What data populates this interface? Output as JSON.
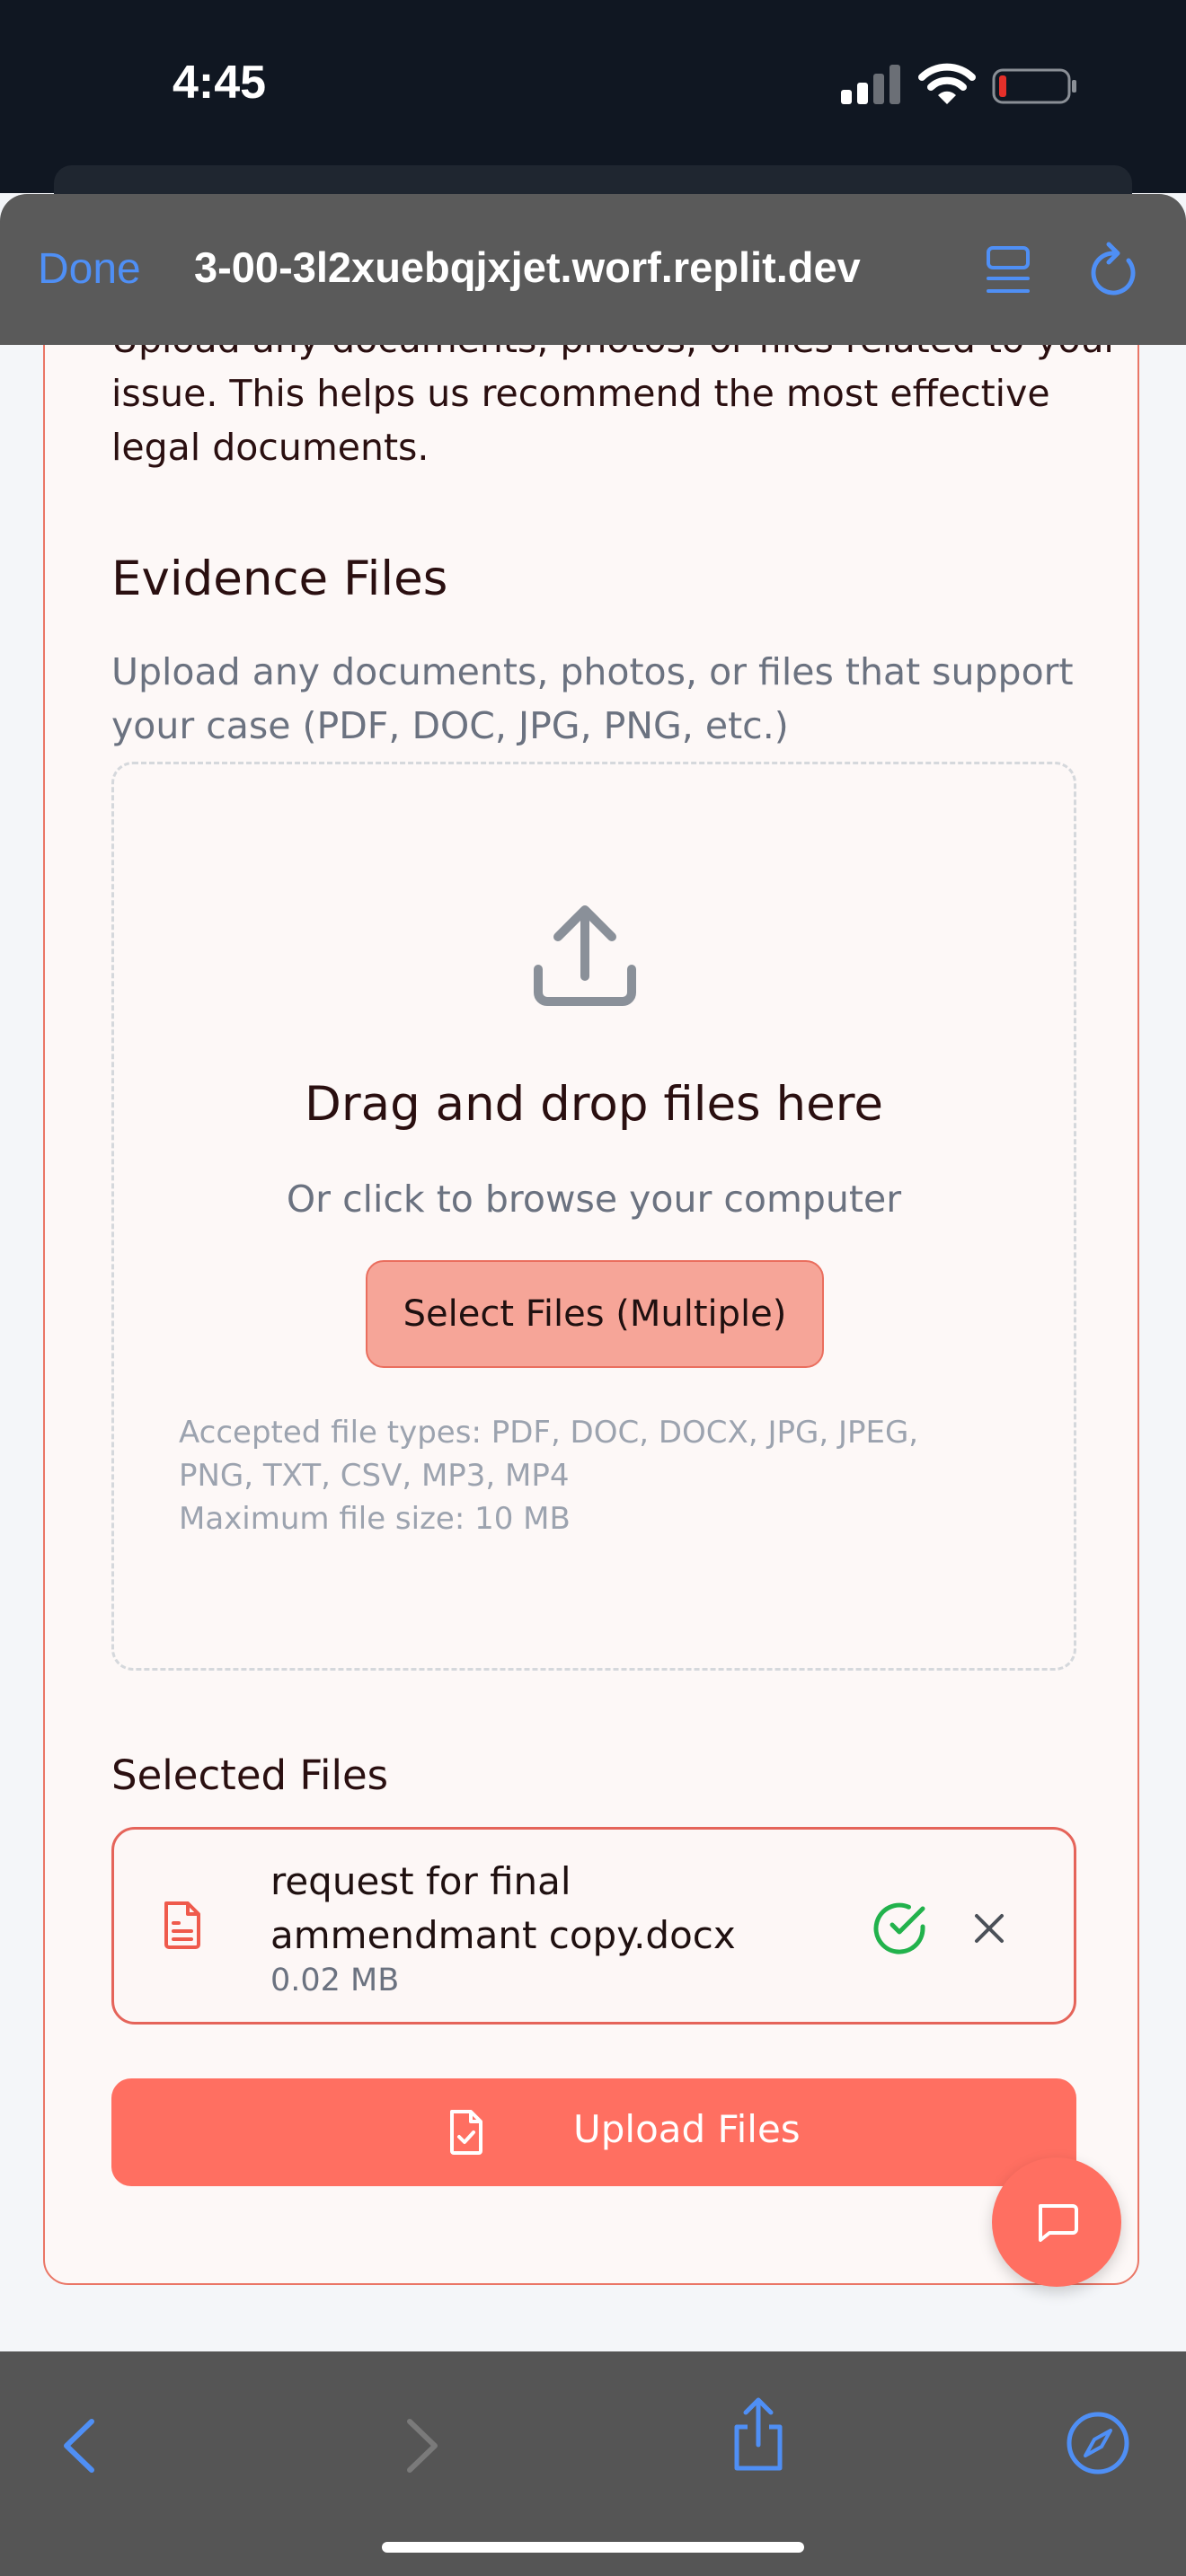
{
  "status_bar": {
    "time": "4:45",
    "icons": [
      "signal-icon",
      "wifi-icon",
      "battery-low-icon"
    ]
  },
  "browser": {
    "done_label": "Done",
    "url": "3-00-3l2xuebqjxjet.worf.replit.dev",
    "icons": [
      "reader-icon",
      "reload-icon"
    ]
  },
  "page": {
    "intro_text": "Upload any documents, photos, or files related to your issue. This helps us recommend the most effective legal documents.",
    "evidence": {
      "title": "Evidence Files",
      "description": "Upload any documents, photos, or files that support your case (PDF, DOC, JPG, PNG, etc.)"
    },
    "dropzone": {
      "title": "Drag and drop files here",
      "subtitle": "Or click to browse your computer",
      "button_label": "Select Files (Multiple)",
      "accepted_types": "Accepted file types: PDF, DOC, DOCX, JPG, JPEG, PNG, TXT, CSV, MP3, MP4",
      "max_size": "Maximum file size: 10 MB"
    },
    "selected": {
      "title": "Selected Files",
      "files": [
        {
          "name": "request for final ammendmant copy.docx",
          "size": "0.02 MB",
          "status": "uploaded"
        }
      ]
    },
    "upload_button_label": "Upload Files"
  },
  "colors": {
    "accent": "#ff6f61",
    "accent_light": "#f6a598",
    "success": "#22b24c",
    "ios_blue": "#4f8ff5"
  },
  "bottom_bar": {
    "icons": [
      "back-icon",
      "forward-icon",
      "share-icon",
      "compass-icon"
    ]
  }
}
